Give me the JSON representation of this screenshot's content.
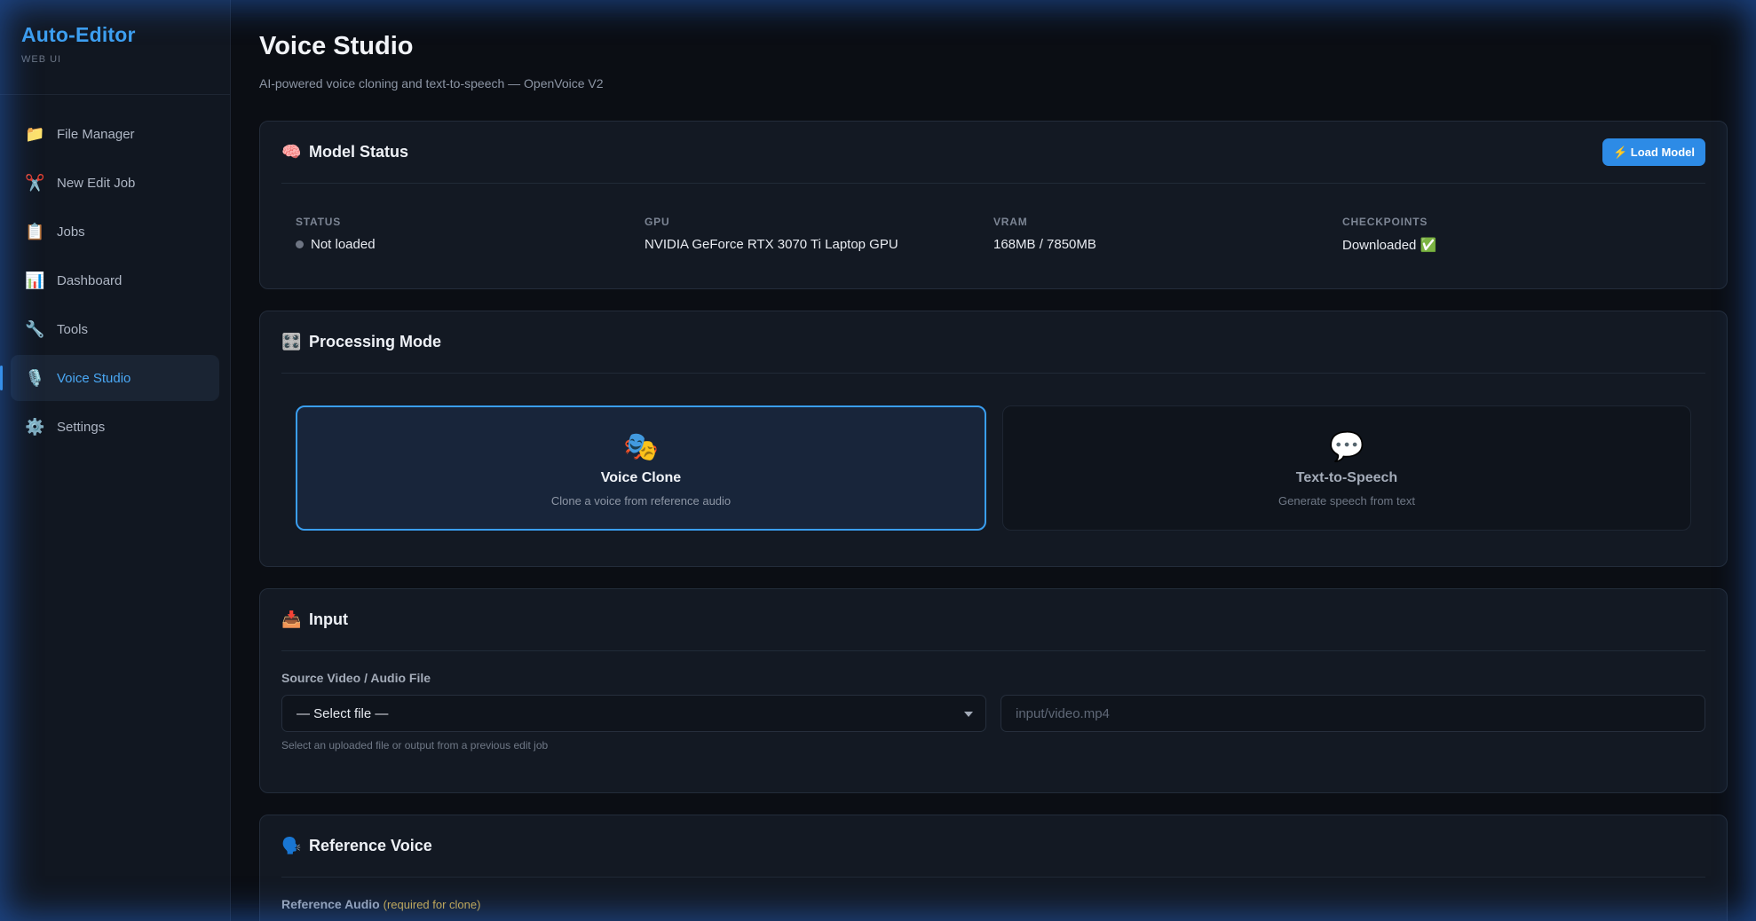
{
  "brand": {
    "title": "Auto-Editor",
    "subtitle": "WEB UI"
  },
  "sidebar": {
    "items": [
      {
        "label": "File Manager",
        "icon": "folder-icon",
        "glyph": "📁"
      },
      {
        "label": "New Edit Job",
        "icon": "scissors-icon",
        "glyph": "✂️"
      },
      {
        "label": "Jobs",
        "icon": "clipboard-icon",
        "glyph": "📋"
      },
      {
        "label": "Dashboard",
        "icon": "bar-chart-icon",
        "glyph": "📊"
      },
      {
        "label": "Tools",
        "icon": "wrench-icon",
        "glyph": "🔧"
      },
      {
        "label": "Voice Studio",
        "icon": "microphone-icon",
        "glyph": "🎙️",
        "active": true
      },
      {
        "label": "Settings",
        "icon": "gear-icon",
        "glyph": "⚙️"
      }
    ]
  },
  "page": {
    "title": "Voice Studio",
    "subtitle": "AI-powered voice cloning and text-to-speech — OpenVoice V2"
  },
  "model_status": {
    "title": "Model Status",
    "icon": "brain-icon",
    "glyph": "🧠",
    "load_button": "⚡ Load Model",
    "stats": [
      {
        "label": "STATUS",
        "value": "Not loaded"
      },
      {
        "label": "GPU",
        "value": "NVIDIA GeForce RTX 3070 Ti Laptop GPU"
      },
      {
        "label": "VRAM",
        "value": "168MB / 7850MB"
      },
      {
        "label": "CHECKPOINTS",
        "value": "Downloaded ✅"
      }
    ]
  },
  "processing_mode": {
    "title": "Processing Mode",
    "icon": "control-knobs-icon",
    "glyph": "🎛️",
    "modes": [
      {
        "title": "Voice Clone",
        "desc": "Clone a voice from reference audio",
        "icon": "theater-masks-icon",
        "glyph": "🎭",
        "selected": true
      },
      {
        "title": "Text-to-Speech",
        "desc": "Generate speech from text",
        "icon": "speech-bubble-icon",
        "glyph": "💬",
        "selected": false
      }
    ]
  },
  "input": {
    "title": "Input",
    "icon": "inbox-tray-icon",
    "glyph": "📥",
    "source_label": "Source Video / Audio File",
    "select_value": "— Select file —",
    "path_placeholder": "input/video.mp4",
    "hint": "Select an uploaded file or output from a previous edit job"
  },
  "reference_voice": {
    "title": "Reference Voice",
    "icon": "speaking-head-icon",
    "glyph": "🗣️",
    "audio_label": "Reference Audio",
    "audio_required": "(required for clone)"
  },
  "colors": {
    "accent": "#3ea0f0",
    "background": "#0b0e14",
    "card": "#131923",
    "required": "#d9b34a"
  }
}
